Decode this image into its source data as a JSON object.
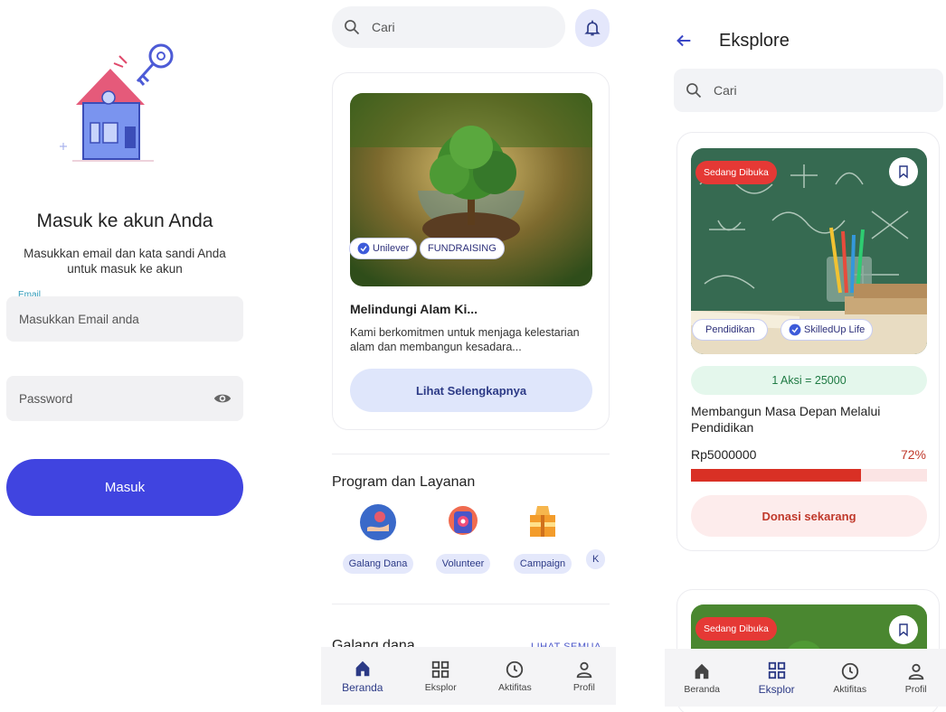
{
  "login": {
    "title": "Masuk ke akun Anda",
    "subtitle": "Masukkan email dan kata sandi Anda untuk masuk ke akun",
    "email_label": "Email",
    "email_placeholder": "Masukkan Email anda",
    "password_placeholder": "Password",
    "submit_label": "Masuk",
    "colors": {
      "primary": "#4044e0",
      "label": "#2f9ab8"
    }
  },
  "home": {
    "search_placeholder": "Cari",
    "featured": {
      "chips": [
        "Unilever",
        "FUNDRAISING"
      ],
      "title": "Melindungi Alam Ki...",
      "description": "Kami berkomitmen untuk menjaga kelestarian alam dan membangun kesadara...",
      "button_label": "Lihat Selengkapnya"
    },
    "services_title": "Program dan Layanan",
    "services": [
      {
        "label": "Galang Dana",
        "icon": "fundraise-icon"
      },
      {
        "label": "Volunteer",
        "icon": "volunteer-icon"
      },
      {
        "label": "Campaign",
        "icon": "campaign-icon"
      },
      {
        "label": "K",
        "icon": "more-service-icon"
      }
    ],
    "galang_title": "Galang dana",
    "see_all": "LIHAT SEMUA",
    "nav": [
      {
        "label": "Beranda",
        "icon": "home-icon",
        "active": true
      },
      {
        "label": "Eksplor",
        "icon": "grid-icon",
        "active": false
      },
      {
        "label": "Aktifitas",
        "icon": "clock-icon",
        "active": false
      },
      {
        "label": "Profil",
        "icon": "user-icon",
        "active": false
      }
    ]
  },
  "explore": {
    "title": "Eksplore",
    "search_placeholder": "Cari",
    "cards": [
      {
        "status": "Sedang Dibuka",
        "chips": [
          "Pendidikan",
          "SkilledUp Life"
        ],
        "aksi": "1 Aksi = 25000",
        "title": "Membangun Masa Depan Melalui Pendidikan",
        "amount": "Rp5000000",
        "percent_label": "72%",
        "progress": 0.72,
        "button_label": "Donasi sekarang"
      },
      {
        "status": "Sedang Dibuka"
      }
    ],
    "nav": [
      {
        "label": "Beranda",
        "icon": "home-icon",
        "active": false
      },
      {
        "label": "Eksplor",
        "icon": "grid-icon",
        "active": true
      },
      {
        "label": "Aktifitas",
        "icon": "clock-icon",
        "active": false
      },
      {
        "label": "Profil",
        "icon": "user-icon",
        "active": false
      }
    ]
  }
}
